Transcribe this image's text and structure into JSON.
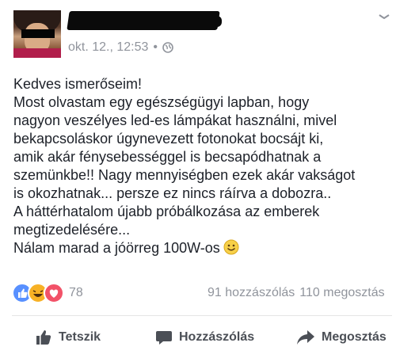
{
  "post": {
    "timestamp": "okt. 12., 12:53",
    "separator": "•",
    "text_lines": [
      "Kedves ismerőseim!",
      "Most olvastam egy egészségügyi lapban, hogy",
      "nagyon veszélyes led-es lámpákat használni, mivel",
      "bekapcsoláskor úgynevezett fotonokat bocsájt ki,",
      "amik akár fénysebességgel is becsapódhatnak a",
      "szemünkbe!! Nagy mennyiségben ezek akár vakságot",
      "is okozhatnak... persze ez nincs ráírva a dobozra..",
      "A háttérhatalom újabb próbálkozása az emberek",
      "megtizedelésére...",
      "Nálam marad a jóörreg 100W-os"
    ]
  },
  "stats": {
    "reaction_count": "78",
    "comments": "91 hozzászólás",
    "shares": "110 megosztás"
  },
  "actions": {
    "like": "Tetszik",
    "comment": "Hozzászólás",
    "share": "Megosztás"
  },
  "colors": {
    "like_blue": "#5890ff",
    "haha_yellow": "#f7b125",
    "love_red": "#f25268",
    "meta_gray": "#90949c",
    "text": "#1d2129"
  },
  "icons": {
    "privacy": "globe-icon",
    "emoji": "smiley-icon",
    "like": "thumbs-up-icon",
    "comment": "speech-bubble-icon",
    "share": "share-arrow-icon"
  }
}
